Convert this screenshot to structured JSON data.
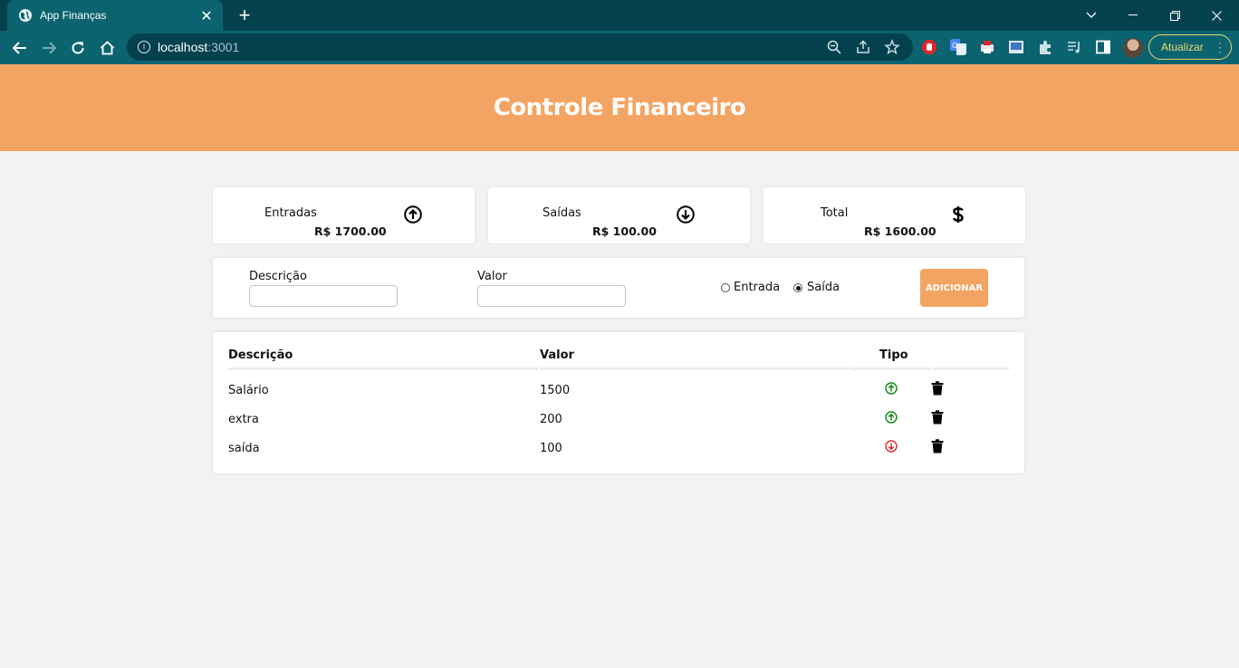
{
  "browser": {
    "tab_title": "App Finanças",
    "tab_close": "✕",
    "new_tab": "+",
    "url_host": "localhost",
    "url_port": ":3001",
    "update_label": "Atualizar"
  },
  "app": {
    "title": "Controle Financeiro"
  },
  "summary": {
    "income_label": "Entradas",
    "income_value": "R$ 1700.00",
    "expense_label": "Saídas",
    "expense_value": "R$ 100.00",
    "total_label": "Total",
    "total_value": "R$ 1600.00"
  },
  "form": {
    "description_label": "Descrição",
    "description_value": "",
    "amount_label": "Valor",
    "amount_value": "",
    "radio_income_label": "Entrada",
    "radio_expense_label": "Saída",
    "selected_type": "Saída",
    "add_button_label": "ADICIONAR"
  },
  "table": {
    "headers": [
      "Descrição",
      "Valor",
      "Tipo"
    ],
    "rows": [
      {
        "description": "Salário",
        "amount": "1500",
        "type": "income"
      },
      {
        "description": "extra",
        "amount": "200",
        "type": "income"
      },
      {
        "description": "saída",
        "amount": "100",
        "type": "expense"
      }
    ]
  },
  "colors": {
    "header_bg": "#f4a462",
    "income_icon": "#0a8a14",
    "expense_icon": "#e0262a",
    "browser_dark": "#03414f",
    "browser_toolbar": "#0b6370"
  },
  "icons": {
    "income_card": "arrow-circle-up-icon",
    "expense_card": "arrow-circle-down-icon",
    "total_card": "dollar-icon",
    "delete": "trash-icon"
  }
}
